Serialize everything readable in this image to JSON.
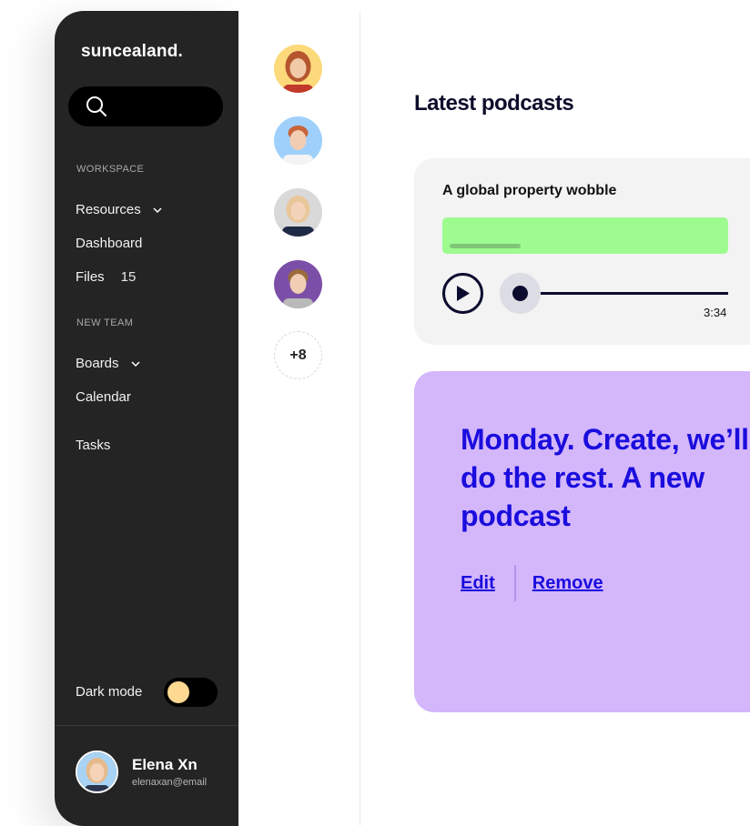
{
  "sidebar": {
    "brand": "suncealand.",
    "search": {
      "placeholder": ""
    },
    "sections": [
      {
        "label": "WORKSPACE"
      },
      {
        "label": "NEW TEAM"
      }
    ],
    "workspace_items": [
      {
        "label": "Resources",
        "icon": "chevron-down-icon"
      },
      {
        "label": "Dashboard"
      },
      {
        "label": "Files",
        "count": "15"
      }
    ],
    "team_items": [
      {
        "label": "Boards",
        "icon": "chevron-down-icon"
      },
      {
        "label": "Calendar"
      },
      {
        "label": "Tasks"
      }
    ],
    "dark_mode": {
      "label": "Dark mode",
      "enabled": false,
      "knob_color": "#ffd992"
    },
    "user": {
      "name": "Elena Xn",
      "email": "elenaxan@email"
    }
  },
  "team_avatars": {
    "avatars": [
      {
        "bg": "#fcd97a"
      },
      {
        "bg": "#9fd0fb"
      },
      {
        "bg": "#d9d9d9"
      },
      {
        "bg": "#7b4fa8"
      }
    ],
    "more": "+8"
  },
  "main": {
    "title": "Latest podcasts",
    "podcast": {
      "title": "A global property wobble",
      "duration": "3:34",
      "progress": 0
    },
    "promo": {
      "text": "Monday. Create, we’ll\ndo the rest. A new\npodcast",
      "edit_label": "Edit",
      "remove_label": "Remove"
    }
  },
  "colors": {
    "sidebar_bg": "#242424",
    "accent_green": "#9dfb8f",
    "promo_bg": "#d4b6fb",
    "promo_text": "#1a0ddd",
    "dark_navy": "#0b0b2e"
  }
}
